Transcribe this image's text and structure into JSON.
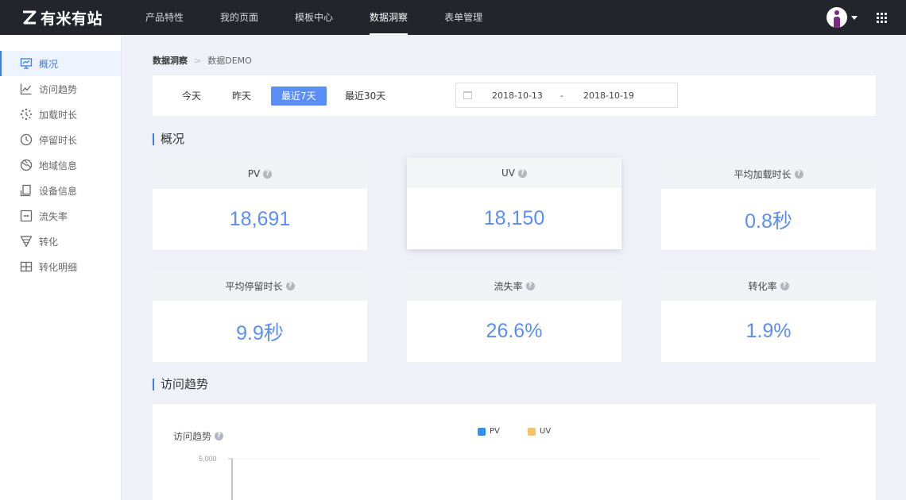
{
  "app": {
    "logo_text": "有米有站",
    "nav": [
      "产品特性",
      "我的页面",
      "模板中心",
      "数据洞察",
      "表单管理"
    ],
    "nav_active": "数据洞察"
  },
  "sidebar": {
    "items": [
      {
        "label": "概况",
        "icon": "monitor-icon"
      },
      {
        "label": "访问趋势",
        "icon": "line-chart-icon"
      },
      {
        "label": "加载时长",
        "icon": "loading-icon"
      },
      {
        "label": "停留时长",
        "icon": "clock-icon"
      },
      {
        "label": "地域信息",
        "icon": "globe-icon"
      },
      {
        "label": "设备信息",
        "icon": "device-icon"
      },
      {
        "label": "流失率",
        "icon": "minus-box-icon"
      },
      {
        "label": "转化",
        "icon": "funnel-icon"
      },
      {
        "label": "转化明细",
        "icon": "grid-icon"
      }
    ],
    "active": "概况"
  },
  "breadcrumb": {
    "root": "数据洞察",
    "current": "数据DEMO"
  },
  "filter": {
    "ranges": [
      "今天",
      "昨天",
      "最近7天",
      "最近30天"
    ],
    "active_range": "最近7天",
    "date_start": "2018-10-13",
    "date_separator": "-",
    "date_end": "2018-10-19"
  },
  "overview": {
    "title": "概况",
    "metrics": [
      {
        "label": "PV",
        "value": "18,691"
      },
      {
        "label": "UV",
        "value": "18,150"
      },
      {
        "label": "平均加载时长",
        "value": "0.8秒"
      },
      {
        "label": "平均停留时长",
        "value": "9.9秒"
      },
      {
        "label": "流失率",
        "value": "26.6%"
      },
      {
        "label": "转化率",
        "value": "1.9%"
      }
    ]
  },
  "trend": {
    "section_title": "访问趋势",
    "chart_title": "访问趋势",
    "legend": [
      {
        "name": "PV",
        "color": "#2f8ff3"
      },
      {
        "name": "UV",
        "color": "#f5c36b"
      }
    ],
    "y_tick_label": "5,000"
  },
  "colors": {
    "accent": "#3a7cf3",
    "metric_value": "#5b8ef5",
    "topbar": "#22262c"
  }
}
